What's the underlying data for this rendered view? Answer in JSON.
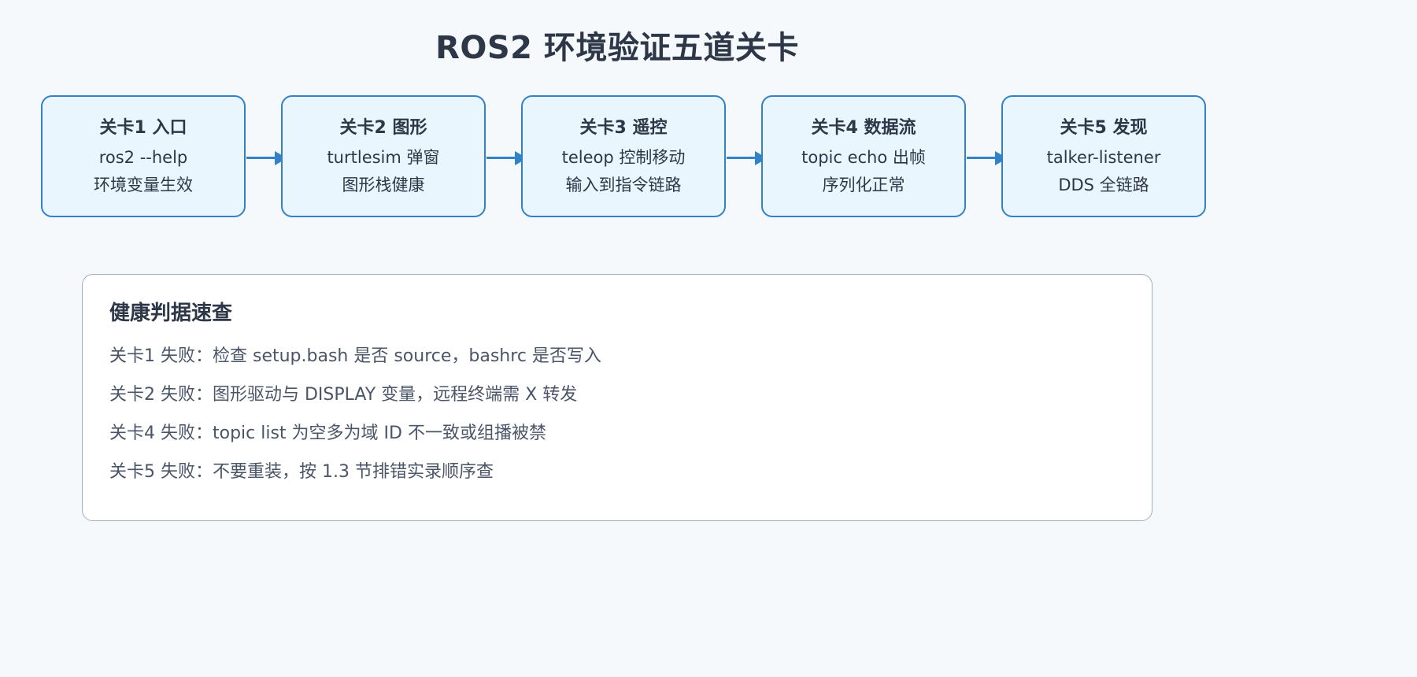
{
  "title": "ROS2 环境验证五道关卡",
  "stages": [
    {
      "title": "关卡1 入口",
      "line1": "ros2 --help",
      "line2": "环境变量生效"
    },
    {
      "title": "关卡2 图形",
      "line1": "turtlesim 弹窗",
      "line2": "图形栈健康"
    },
    {
      "title": "关卡3 遥控",
      "line1": "teleop 控制移动",
      "line2": "输入到指令链路"
    },
    {
      "title": "关卡4 数据流",
      "line1": "topic echo 出帧",
      "line2": "序列化正常"
    },
    {
      "title": "关卡5 发现",
      "line1": "talker-listener",
      "line2": "DDS 全链路"
    }
  ],
  "panel": {
    "title": "健康判据速查",
    "items": [
      "关卡1 失败：检查 setup.bash 是否 source，bashrc 是否写入",
      "关卡2 失败：图形驱动与 DISPLAY 变量，远程终端需 X 转发",
      "关卡4 失败：topic list 为空多为域 ID 不一致或组播被禁",
      "关卡5 失败：不要重装，按 1.3 节排错实录顺序查"
    ]
  },
  "colors": {
    "accent": "#3282c8",
    "stage_fill": "#eaf6fe",
    "background": "#f5f9fc",
    "text": "#2d3748"
  }
}
